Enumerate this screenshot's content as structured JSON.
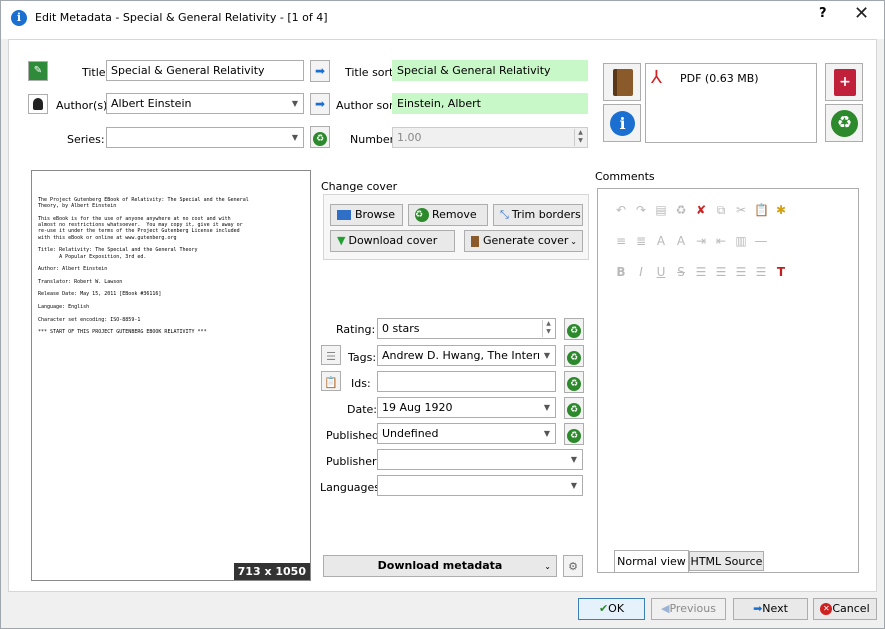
{
  "window": {
    "title": "Edit Metadata - Special & General Relativity -  [1 of 4]",
    "help": "?",
    "close": "✕"
  },
  "fields": {
    "title_label": "Title:",
    "title_value": "Special & General Relativity",
    "title_sort_label": "Title sort:",
    "title_sort_value": "Special & General Relativity",
    "authors_label": "Author(s):",
    "authors_value": "Albert Einstein",
    "author_sort_label": "Author sort:",
    "author_sort_value": "Einstein, Albert",
    "series_label": "Series:",
    "series_value": "",
    "number_label": "Number:",
    "number_value": "1.00"
  },
  "format": {
    "label": "PDF (0.63 MB)"
  },
  "cover": {
    "size": "713 x 1050",
    "lines": [
      "The Project Gutenberg EBook of Relativity: The Special and the General",
      "Theory, by Albert Einstein",
      "",
      "This eBook is for the use of anyone anywhere at no cost and with",
      "almost no restrictions whatsoever.  You may copy it, give it away or",
      "re-use it under the terms of the Project Gutenberg License included",
      "with this eBook or online at www.gutenberg.org",
      "",
      "Title: Relativity: The Special and the General Theory",
      "       A Popular Exposition, 3rd ed.",
      "",
      "Author: Albert Einstein",
      "",
      "Translator: Robert W. Lawson",
      "",
      "Release Date: May 15, 2011 [EBook #36116]",
      "",
      "Language: English",
      "",
      "Character set encoding: ISO-8859-1",
      "",
      "*** START OF THIS PROJECT GUTENBERG EBOOK RELATIVITY ***"
    ]
  },
  "change_cover": {
    "heading": "Change cover",
    "browse": "Browse",
    "remove": "Remove",
    "trim": "Trim borders",
    "download": "Download cover",
    "generate": "Generate cover"
  },
  "meta": {
    "rating_label": "Rating:",
    "rating_value": "0 stars",
    "tags_label": "Tags:",
    "tags_value": "Andrew D. Hwang, The Internet Arch",
    "ids_label": "Ids:",
    "ids_value": "",
    "date_label": "Date:",
    "date_value": "19 Aug 1920",
    "published_label": "Published:",
    "published_value": "Undefined",
    "publisher_label": "Publisher:",
    "publisher_value": "",
    "languages_label": "Languages:",
    "languages_value": ""
  },
  "download_metadata": "Download metadata",
  "comments": {
    "label": "Comments",
    "tab_normal": "Normal view",
    "tab_html": "HTML Source"
  },
  "bottom": {
    "ok": "OK",
    "previous": "Previous",
    "next": "Next",
    "cancel": "Cancel"
  },
  "colors": {
    "green_field": "#c8f7c8",
    "accent": "#1a6fd1",
    "recycle": "#2c8a2c",
    "book_red": "#c0203a"
  }
}
